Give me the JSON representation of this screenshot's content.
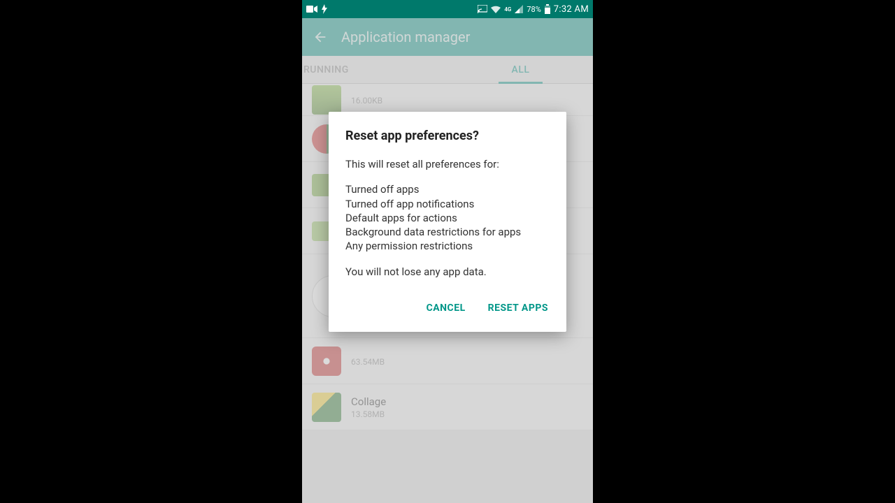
{
  "status": {
    "battery_pct": "78%",
    "time": "7:32 AM"
  },
  "appbar": {
    "title": "Application manager"
  },
  "tabs": {
    "running": "RUNNING",
    "all": "ALL"
  },
  "list": {
    "row0_size": "16.00KB",
    "row4_size": "63.54MB",
    "row5_name": "Collage",
    "row5_size": "13.58MB"
  },
  "dialog": {
    "title": "Reset app preferences?",
    "intro": "This will reset all preferences for:",
    "items": {
      "a": "Turned off apps",
      "b": "Turned off app notifications",
      "c": "Default apps for actions",
      "d": "Background data restrictions for apps",
      "e": "Any permission restrictions"
    },
    "footer": "You will not lose any app data.",
    "cancel": "CANCEL",
    "confirm": "RESET APPS"
  }
}
